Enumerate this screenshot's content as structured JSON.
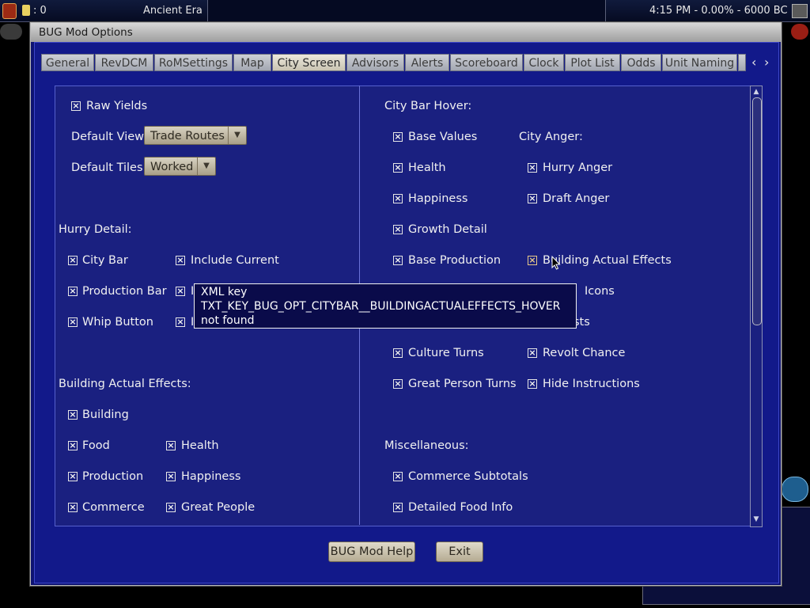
{
  "game_bar": {
    "gold": ": 0",
    "era": "Ancient Era",
    "status": "4:15 PM - 0.00% - 6000 BC"
  },
  "window": {
    "title": "BUG Mod Options"
  },
  "tabs": [
    "General",
    "RevDCM",
    "RoMSettings",
    "Map",
    "City Screen",
    "Advisors",
    "Alerts",
    "Scoreboard",
    "Clock",
    "Plot List",
    "Odds",
    "Unit Naming"
  ],
  "active_tab": "City Screen",
  "left": {
    "raw_yields": "Raw Yields",
    "default_view_label": "Default View",
    "default_view_value": "Trade Routes",
    "default_tiles_label": "Default Tiles",
    "default_tiles_value": "Worked",
    "hurry_header": "Hurry Detail:",
    "hurry": {
      "city_bar": "City Bar",
      "include_current": "Include Current",
      "production_bar": "Production Bar",
      "whip_button": "Whip Button",
      "i2": "I",
      "i3": "I"
    },
    "bae_header": "Building Actual Effects:",
    "bae": {
      "building": "Building",
      "food": "Food",
      "health": "Health",
      "production": "Production",
      "happiness": "Happiness",
      "commerce": "Commerce",
      "great_people": "Great People"
    }
  },
  "right": {
    "hover_header": "City Bar Hover:",
    "base_values": "Base Values",
    "city_anger_header": "City Anger:",
    "health": "Health",
    "hurry_anger": "Hurry Anger",
    "happiness": "Happiness",
    "draft_anger": "Draft Anger",
    "growth_detail": "Growth Detail",
    "base_production": "Base Production",
    "building_actual_effects": "Building Actual Effects",
    "icons_partial": "Icons",
    "sts_partial": "sts",
    "culture_turns": "Culture Turns",
    "revolt_chance": "Revolt Chance",
    "great_person_turns": "Great Person Turns",
    "hide_instructions": "Hide Instructions",
    "misc_header": "Miscellaneous:",
    "commerce_subtotals": "Commerce Subtotals",
    "detailed_food_info": "Detailed Food Info"
  },
  "tooltip": {
    "line1": "XML key",
    "line2": "TXT_KEY_BUG_OPT_CITYBAR__BUILDINGACTUALEFFECTS_HOVER",
    "line3": "not found"
  },
  "buttons": {
    "help": "BUG Mod Help",
    "exit": "Exit"
  },
  "checkbox_mark": "×",
  "colors": {
    "window_bg": "#12198a",
    "panel_bg": "#1a2080",
    "tooltip_bg": "#0a0b4a",
    "highlight_check": "#e8c98a"
  }
}
